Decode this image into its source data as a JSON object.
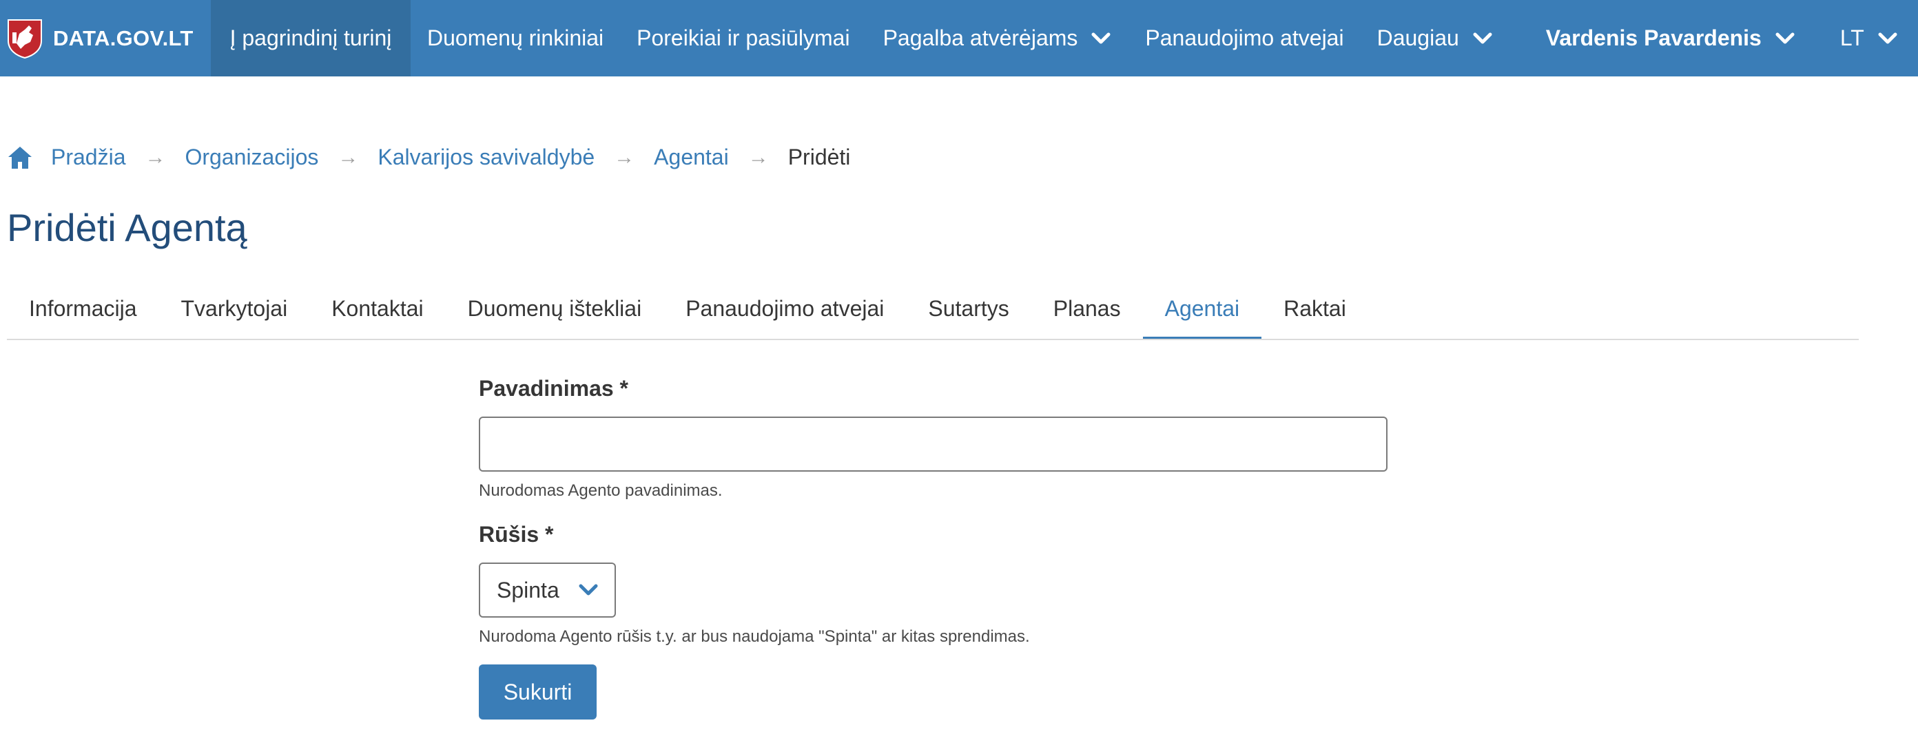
{
  "navbar": {
    "brand": "DATA.GOV.LT",
    "items": [
      {
        "label": "Į pagrindinį turinį",
        "active": true
      },
      {
        "label": "Duomenų rinkiniai"
      },
      {
        "label": "Poreikiai ir pasiūlymai"
      },
      {
        "label": "Pagalba atvėrėjams",
        "dropdown": true
      },
      {
        "label": "Panaudojimo atvejai"
      },
      {
        "label": "Daugiau",
        "dropdown": true
      }
    ],
    "user": "Vardenis Pavardenis",
    "language": "LT"
  },
  "breadcrumb": {
    "home_icon": "home-icon",
    "items": [
      "Pradžia",
      "Organizacijos",
      "Kalvarijos savivaldybė",
      "Agentai"
    ],
    "current": "Pridėti",
    "separator": "→"
  },
  "page": {
    "title": "Pridėti Agentą"
  },
  "tabs": [
    {
      "label": "Informacija"
    },
    {
      "label": "Tvarkytojai"
    },
    {
      "label": "Kontaktai"
    },
    {
      "label": "Duomenų ištekliai"
    },
    {
      "label": "Panaudojimo atvejai"
    },
    {
      "label": "Sutartys"
    },
    {
      "label": "Planas"
    },
    {
      "label": "Agentai",
      "active": true
    },
    {
      "label": "Raktai"
    }
  ],
  "form": {
    "name_label": "Pavadinimas *",
    "name_value": "",
    "name_help": "Nurodomas Agento pavadinimas.",
    "type_label": "Rūšis *",
    "type_value": "Spinta",
    "type_help": "Nurodoma Agento rūšis t.y. ar bus naudojama \"Spinta\" ar kitas sprendimas.",
    "submit_label": "Sukurti"
  },
  "colors": {
    "navbar": "#3a7db7",
    "navbar_active": "#336e9f",
    "link": "#3a7db7",
    "title": "#234d7a",
    "button": "#3a7db7"
  }
}
